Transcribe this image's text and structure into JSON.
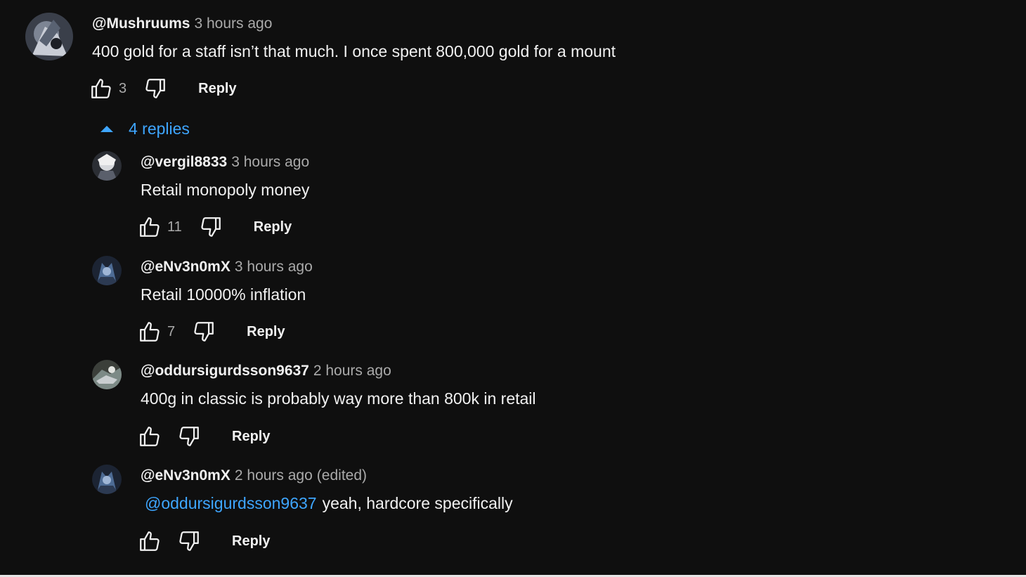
{
  "top_comment": {
    "author": "@Mushruums",
    "time": "3 hours ago",
    "text": "400 gold for a staff isn’t that much. I once spent 800,000 gold for a mount",
    "likes": "3",
    "reply_label": "Reply"
  },
  "replies_toggle": {
    "label": "4 replies"
  },
  "replies": [
    {
      "author": "@vergil8833",
      "time": "3 hours ago",
      "text": "Retail monopoly money",
      "likes": "11",
      "reply_label": "Reply"
    },
    {
      "author": "@eNv3n0mX",
      "time": "3 hours ago",
      "text": "Retail 10000% inflation",
      "likes": "7",
      "reply_label": "Reply"
    },
    {
      "author": "@oddursigurdsson9637",
      "time": "2 hours ago",
      "text": "400g in classic is probably way more than 800k in retail",
      "likes": "",
      "reply_label": "Reply"
    },
    {
      "author": "@eNv3n0mX",
      "time": "2 hours ago",
      "edited": "(edited)",
      "mention": "@oddursigurdsson9637",
      "text": "yeah, hardcore specifically",
      "likes": "",
      "reply_label": "Reply"
    }
  ],
  "icons": {
    "like": "thumb-up-icon",
    "dislike": "thumb-down-icon",
    "collapse": "caret-up-icon"
  },
  "colors": {
    "background": "#0f0f0f",
    "link": "#3ea6ff",
    "secondary_text": "#aaaaaa",
    "primary_text": "#f1f1f1"
  }
}
